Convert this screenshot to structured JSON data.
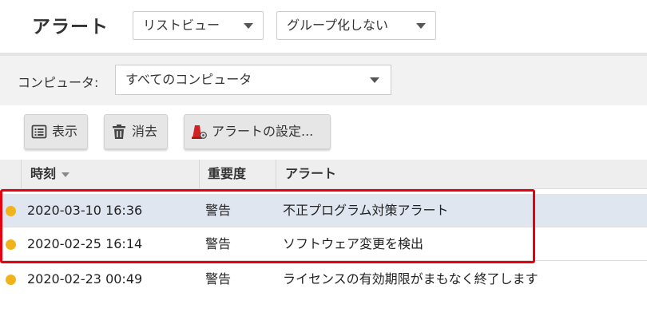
{
  "page": {
    "title": "アラート"
  },
  "view_dropdown": {
    "value": "リストビュー"
  },
  "group_dropdown": {
    "value": "グループ化しない"
  },
  "filter": {
    "label": "コンピュータ:",
    "value": "すべてのコンピュータ"
  },
  "toolbar": {
    "view_label": "表示",
    "delete_label": "消去",
    "settings_label": "アラートの設定..."
  },
  "table": {
    "columns": [
      "時刻",
      "重要度",
      "アラート"
    ],
    "rows": [
      {
        "time": "2020-03-10 16:36",
        "severity": "警告",
        "alert": "不正プログラム対策アラート",
        "selected": true
      },
      {
        "time": "2020-02-25 16:14",
        "severity": "警告",
        "alert": "ソフトウェア変更を検出",
        "selected": false
      },
      {
        "time": "2020-02-23 00:49",
        "severity": "警告",
        "alert": "ライセンスの有効期限がまもなく終了します",
        "selected": false
      }
    ]
  },
  "colors": {
    "warning_dot": "#f0b41a",
    "selection": "#dfe6f0",
    "highlight_border": "#e8000f",
    "settings_icon": "#d32020"
  },
  "icons": {
    "view": "list-view-icon",
    "delete": "trash-icon",
    "settings": "alert-settings-icon",
    "sort": "chevron-down-icon"
  }
}
